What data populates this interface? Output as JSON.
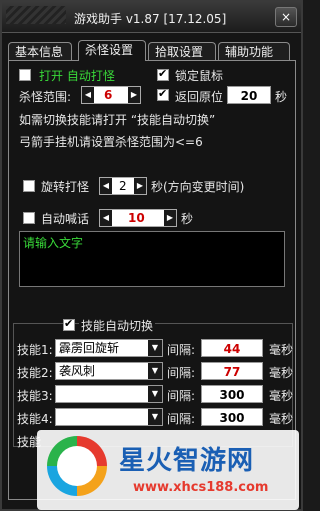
{
  "window": {
    "title": "游戏助手 v1.87 [17.12.05]",
    "close_label": "×"
  },
  "tabs": [
    {
      "label": "基本信息"
    },
    {
      "label": "杀怪设置"
    },
    {
      "label": "拾取设置"
    },
    {
      "label": "辅助功能"
    }
  ],
  "active_tab": "杀怪设置",
  "kill": {
    "enable_label": "打开 自动打怪",
    "enable_checked": false,
    "lock_mouse_label": "锁定鼠标",
    "lock_mouse_checked": true,
    "range_label": "杀怪范围:",
    "range_value": "6",
    "return_label": "返回原位",
    "return_checked": true,
    "return_seconds": "20",
    "seconds_unit": "秒",
    "hint1": "如需切换技能请打开 “技能自动切换”",
    "hint2": "弓箭手挂机请设置杀怪范围为<=6"
  },
  "rotate": {
    "label": "旋转打怪",
    "checked": false,
    "value": "2",
    "suffix": "秒(方向变更时间)"
  },
  "shout": {
    "label": "自动喊话",
    "checked": false,
    "value": "10",
    "unit": "秒",
    "placeholder": "请输入文字"
  },
  "skills": {
    "switch_label": "技能自动切换",
    "switch_checked": true,
    "interval_label": "间隔:",
    "unit": "毫秒",
    "rows": [
      {
        "label": "技能1:",
        "skill": "霹雳回旋斩",
        "interval": "44"
      },
      {
        "label": "技能2:",
        "skill": "袭风刺",
        "interval": "77"
      },
      {
        "label": "技能3:",
        "skill": "",
        "interval": "300"
      },
      {
        "label": "技能4:",
        "skill": "",
        "interval": "300"
      }
    ],
    "partial_label": "技能"
  },
  "watermark": {
    "brand": "星火智游网",
    "url": "www.xhcs188.com"
  }
}
